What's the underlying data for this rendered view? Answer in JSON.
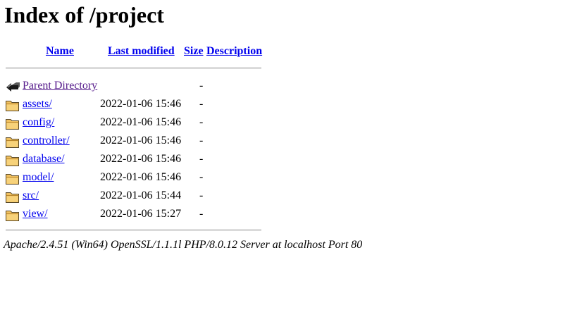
{
  "page": {
    "title": "Index of /project"
  },
  "columns": {
    "name": "Name",
    "last_modified": "Last modified",
    "size": "Size",
    "description": "Description"
  },
  "parent": {
    "label": "Parent Directory",
    "modified": "",
    "size": "-",
    "icon": "back-arrow-icon"
  },
  "entries": [
    {
      "name": "assets/",
      "modified": "2022-01-06 15:46",
      "size": "-",
      "icon": "folder-icon"
    },
    {
      "name": "config/",
      "modified": "2022-01-06 15:46",
      "size": "-",
      "icon": "folder-icon"
    },
    {
      "name": "controller/",
      "modified": "2022-01-06 15:46",
      "size": "-",
      "icon": "folder-icon"
    },
    {
      "name": "database/",
      "modified": "2022-01-06 15:46",
      "size": "-",
      "icon": "folder-icon"
    },
    {
      "name": "model/",
      "modified": "2022-01-06 15:46",
      "size": "-",
      "icon": "folder-icon"
    },
    {
      "name": "src/",
      "modified": "2022-01-06 15:44",
      "size": "-",
      "icon": "folder-icon"
    },
    {
      "name": "view/",
      "modified": "2022-01-06 15:27",
      "size": "-",
      "icon": "folder-icon"
    }
  ],
  "footer": {
    "text": "Apache/2.4.51 (Win64) OpenSSL/1.1.1l PHP/8.0.12 Server at localhost Port 80"
  },
  "colors": {
    "link": "#0000ee",
    "visited_link": "#551a8b",
    "folder_fill": "#f0c060",
    "rule": "#9a9a9a"
  }
}
